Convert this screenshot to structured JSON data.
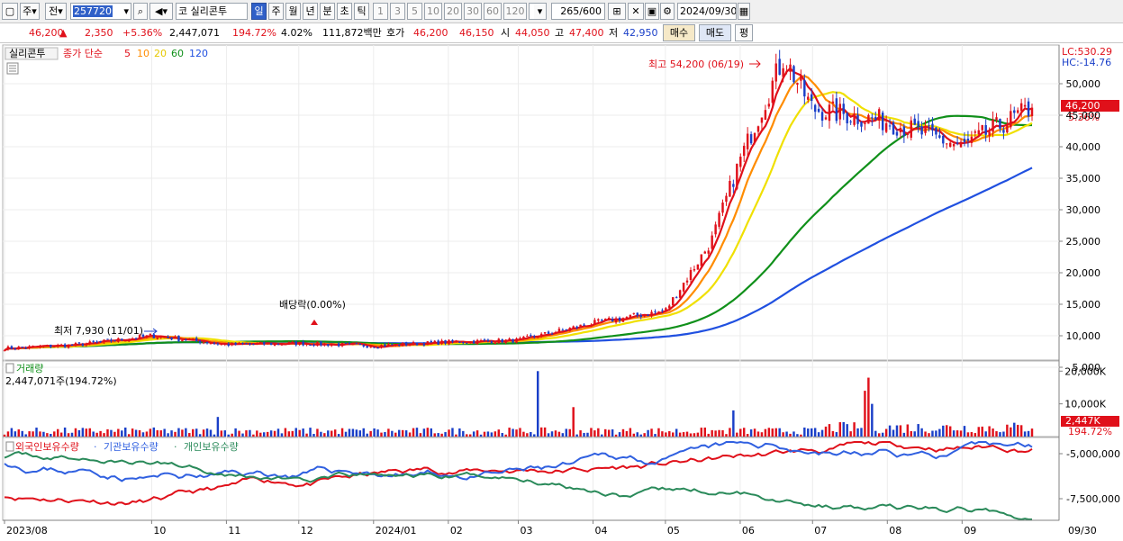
{
  "toolbar": {
    "period_label": "주",
    "compare_label": "전",
    "stock_code": "257720",
    "market_tag": "코",
    "stock_name": "실리콘투",
    "tabs": [
      "일",
      "주",
      "월",
      "년",
      "분",
      "초",
      "틱"
    ],
    "active_tab": "일",
    "intervals": [
      "1",
      "3",
      "5",
      "10",
      "20",
      "30",
      "60",
      "120"
    ],
    "count": "265",
    "count_total": "/600",
    "date": "2024/09/30"
  },
  "quote": {
    "price": "46,200",
    "change": "2,350",
    "change_pct": "+5.36%",
    "volume": "2,447,071",
    "volume_ratio": "194.72%",
    "turnover": "4.02%",
    "trade_value": "111,872백만",
    "bid_label": "호가",
    "ask": "46,200",
    "bid": "46,150",
    "open_label": "시",
    "open": "44,050",
    "high_label": "고",
    "high": "47,400",
    "low_label": "저",
    "low": "42,950",
    "buy_label": "매수",
    "sell_label": "매도",
    "eval_label": "평"
  },
  "colors": {
    "up": "#e0101a",
    "down": "#1a3fc8",
    "ma5": "#e0101a",
    "ma10": "#ff8c00",
    "ma20": "#f0e000",
    "ma60": "#10901a",
    "ma120": "#2050e0",
    "foreign": "#e0101a",
    "institution": "#3060e0",
    "individual": "#2a8a5a"
  },
  "price_panel": {
    "stock_name": "실리콘투",
    "legend_prefix": "종가 단순",
    "ma_labels": [
      "5",
      "10",
      "20",
      "60",
      "120"
    ],
    "lc": "LC:530.29",
    "hc": "HC:-14.76",
    "high_annotation": "최고 54,200 (06/19)",
    "low_annotation": "최저 7,930 (11/01)",
    "dividend_annotation": "배당락(0.00%)",
    "current_price_tag": "46,200",
    "current_pct_tag": "5.36%",
    "y_ticks": [
      "50,000",
      "45,000",
      "40,000",
      "35,000",
      "30,000",
      "25,000",
      "20,000",
      "15,000",
      "10,000",
      "5,000"
    ]
  },
  "volume_panel": {
    "title": "거래량",
    "summary": "2,447,071주(194.72%)",
    "y_ticks": [
      "20,000K",
      "10,000K"
    ],
    "current_tag": "2,447K",
    "current_pct": "194.72%"
  },
  "holding_panel": {
    "legend": [
      "외국인보유수량",
      "기관보유수량",
      "개인보유수량"
    ],
    "y_ticks": [
      "-5,000,000",
      "-7,500,000"
    ]
  },
  "x_axis": {
    "labels": [
      "2023/08",
      "10",
      "11",
      "12",
      "2024/01",
      "02",
      "03",
      "04",
      "05",
      "06",
      "07",
      "08",
      "09"
    ],
    "right_label": "09/30"
  },
  "chart_data": {
    "type": "candlestick",
    "title": "실리콘투",
    "x_range": [
      "2023/08",
      "2024/09/30"
    ],
    "price_ylim": [
      5000,
      55000
    ],
    "close_path": [
      {
        "x": "2023/08",
        "y": 8000
      },
      {
        "x": "2023/09",
        "y": 8600
      },
      {
        "x": "2023/10",
        "y": 10000
      },
      {
        "x": "2023/11",
        "y": 8600
      },
      {
        "x": "2023/12",
        "y": 8800
      },
      {
        "x": "2024/01",
        "y": 8400
      },
      {
        "x": "2024/02",
        "y": 9000
      },
      {
        "x": "2024/03",
        "y": 9300
      },
      {
        "x": "2024/04",
        "y": 12000
      },
      {
        "x": "2024/05",
        "y": 14000
      },
      {
        "x": "2024/05/20",
        "y": 25000
      },
      {
        "x": "2024/06",
        "y": 38000
      },
      {
        "x": "2024/06/19",
        "y": 54200
      },
      {
        "x": "2024/07",
        "y": 46000
      },
      {
        "x": "2024/08",
        "y": 44000
      },
      {
        "x": "2024/09",
        "y": 40000
      },
      {
        "x": "2024/09/30",
        "y": 46200
      }
    ],
    "high": {
      "date": "06/19",
      "value": 54200
    },
    "low": {
      "date": "11/01",
      "value": 7930
    },
    "last": {
      "date": "09/30",
      "close": 46200,
      "open": 44050,
      "high": 47400,
      "low": 42950,
      "volume": 2447071
    },
    "volume_ylim": [
      0,
      22000000
    ],
    "holding_ylim": [
      -8700000,
      -4300000
    ]
  }
}
